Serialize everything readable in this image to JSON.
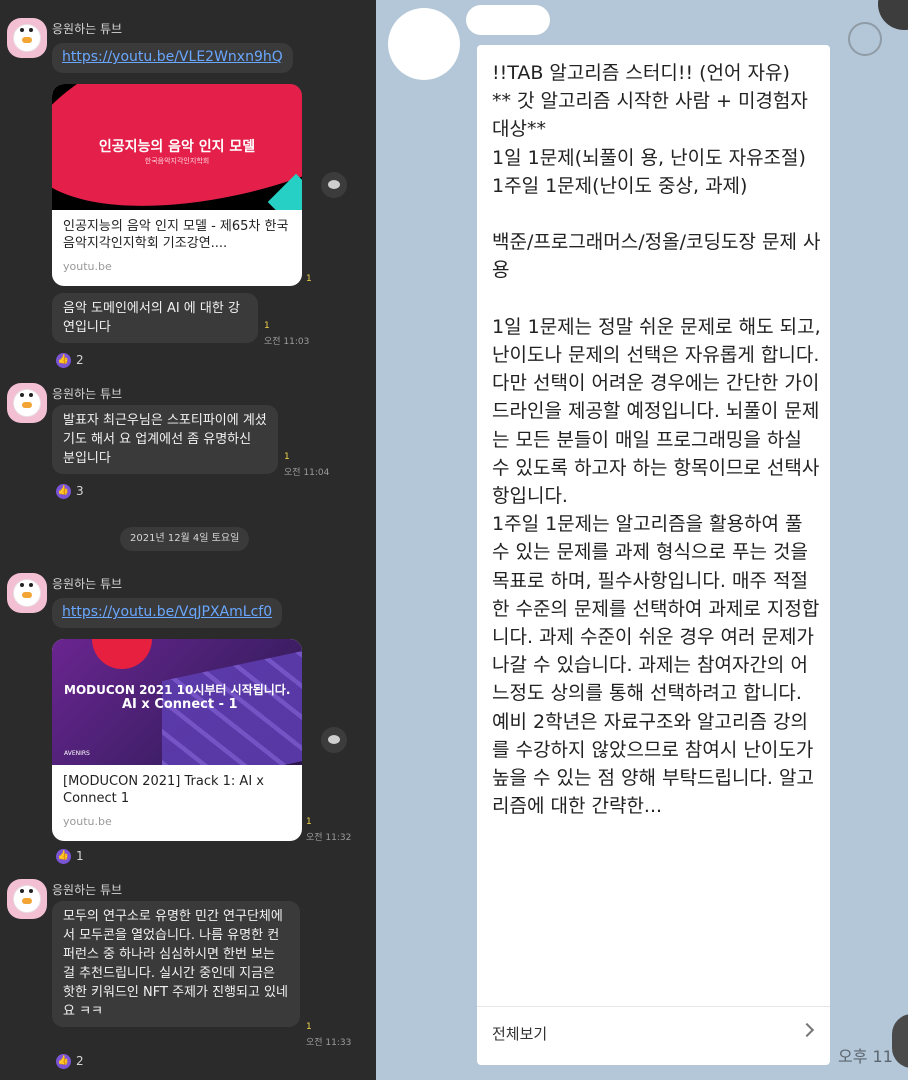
{
  "left": {
    "sender": "응원하는 튜브",
    "link1": "https://youtu.be/VLE2Wnxn9hQ",
    "card1": {
      "thumb_title": "인공지능의 음악 인지 모델",
      "thumb_subtitle": "한국음악지각인지학회",
      "title": "인공지능의 음악 인지 모델 - 제65차 한국음악지각인지학회 기조강연....",
      "source": "youtu.be",
      "unread": "1"
    },
    "msg1": {
      "text": "음악 도메인에서의 AI 에 대한 강연입니다",
      "unread": "1",
      "time": "오전 11:03",
      "reactions": "2"
    },
    "msg2": {
      "text": "발표자 최근우님은 스포티파이에 계셨기도 해서 요 업계에선 좀 유명하신 분입니다",
      "unread": "1",
      "time": "오전 11:04",
      "reactions": "3"
    },
    "date_divider": "2021년 12월 4일 토요일",
    "link2": "https://youtu.be/VqJPXAmLcf0",
    "card2": {
      "thumb_title": "MODUCON 2021 10시부터 시작됩니다.",
      "thumb_subtitle": "AI x Connect - 1",
      "thumb_logo": "AVENIRS",
      "title": "[MODUCON 2021] Track 1: AI x Connect 1",
      "source": "youtu.be",
      "unread": "1",
      "time": "오전 11:32",
      "reactions": "1"
    },
    "msg3": {
      "text": "모두의 연구소로 유명한 민간 연구단체에서 모두콘을 열었습니다. 나름 유명한 컨퍼런스 중 하나라 심심하시면 한번 보는 걸 추천드립니다. 실시간 중인데 지금은 핫한 키워드인 NFT 주제가 진행되고 있네요 ㅋㅋ",
      "unread": "1",
      "time": "오전 11:33",
      "reactions": "2"
    }
  },
  "right": {
    "post_text": "!!TAB 알고리즘 스터디!! (언어 자유)\n** 갓 알고리즘 시작한 사람 + 미경험자 대상**\n1일 1문제(뇌풀이 용, 난이도 자유조절)\n1주일 1문제(난이도 중상, 과제)\n\n백준/프로그래머스/정올/코딩도장 문제 사용\n\n1일 1문제는 정말 쉬운 문제로 해도 되고, 난이도나 문제의 선택은 자유롭게 합니다. 다만 선택이 어려운 경우에는 간단한 가이드라인을 제공할 예정입니다. 뇌풀이 문제는 모든 분들이 매일 프로그래밍을 하실 수 있도록 하고자 하는 항목이므로 선택사항입니다.\n1주일 1문제는 알고리즘을 활용하여 풀 수 있는 문제를 과제 형식으로 푸는 것을 목표로 하며, 필수사항입니다. 매주 적절한 수준의 문제를 선택하여 과제로 지정합니다. 과제 수준이 쉬운 경우 여러 문제가 나갈 수 있습니다. 과제는 참여자간의 어느정도 상의를 통해 선택하려고 합니다.\n예비 2학년은 자료구조와 알고리즘 강의를 수강하지 않았으므로 참여시 난이도가 높을 수 있는 점 양해 부탁드립니다. 알고리즘에 대한 간략한...",
    "more_label": "전체보기",
    "time": "오후 11"
  }
}
